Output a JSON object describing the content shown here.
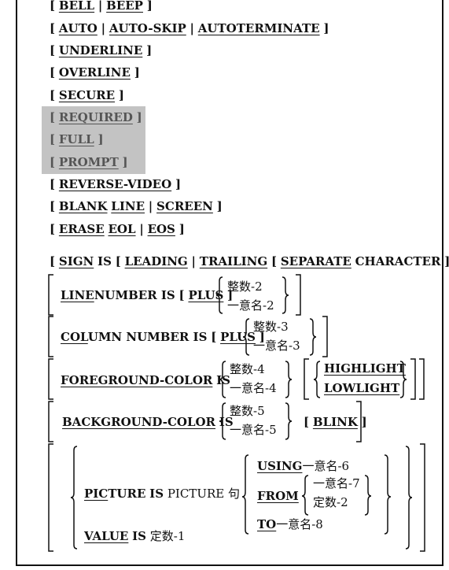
{
  "options": {
    "bell": {
      "open": "[",
      "a": "BELL",
      "sep": "|",
      "b": "BEEP",
      "close": "]"
    },
    "auto": {
      "open": "[",
      "a": "AUTO",
      "sep1": "|",
      "b": "AUTO-SKIP",
      "sep2": "|",
      "c": "AUTOTERMINATE",
      "close": "]"
    },
    "underline": {
      "open": "[",
      "a": "UNDERLINE",
      "close": "]"
    },
    "overline": {
      "open": "[",
      "a": "OVERLINE",
      "close": "]"
    },
    "secure": {
      "open": "[",
      "a": "SECURE",
      "close": "]"
    },
    "required": {
      "open": "[",
      "a": "REQUIRED",
      "close": "]"
    },
    "full": {
      "open": "[",
      "a": "FULL",
      "close": "]"
    },
    "prompt": {
      "open": "[",
      "a": "PROMPT",
      "close": "]"
    },
    "reverse": {
      "open": "[",
      "a": "REVERSE-VIDEO",
      "close": "]"
    },
    "blank": {
      "open": "[",
      "a": "BLANK",
      "a2": "LINE",
      "sep": "|",
      "b": "SCREEN",
      "close": "]"
    },
    "erase": {
      "open": "[",
      "a": "ERASE",
      "a2": "EOL",
      "sep": "|",
      "b": "EOS",
      "close": "]"
    }
  },
  "sign": {
    "open": "[",
    "sign": "SIGN",
    "is": "IS",
    "open2": "[",
    "leading": "LEADING",
    "sep": "|",
    "trailing": "TRAILING",
    "open3": "[",
    "separate": "SEPARATE",
    "character": "CHARACTER",
    "close": "] ]"
  },
  "line_number": {
    "line": "LINE",
    "rest": "NUMBER IS",
    "open": "[",
    "plus": "PLUS",
    "close": "]",
    "opt1": "整数-2",
    "opt2": "一意名-2"
  },
  "column_number": {
    "col": "COL",
    "rest": "UMN NUMBER IS",
    "open": "[",
    "plus": "PLUS",
    "close": "]",
    "opt1": "整数-3",
    "opt2": "一意名-3"
  },
  "foreground": {
    "kw": "FOREGROUND-COLOR",
    "is": "IS",
    "opt1": "整数-4",
    "opt2": "一意名-4",
    "hi": "HIGHLIGHT",
    "lo": "LOWLIGHT"
  },
  "background": {
    "kw": "BACKGROUND-COLOR",
    "is": "IS",
    "opt1": "整数-5",
    "opt2": "一意名-5",
    "open": "[",
    "blink": "BLINK",
    "close": "]"
  },
  "picture": {
    "pic": "PIC",
    "ture": "TURE",
    "is": "IS",
    "clause": "PICTURE 句",
    "using": "USING",
    "using_arg": "一意名-6",
    "from": "FROM",
    "from_opt1": "一意名-7",
    "from_opt2": "定数-2",
    "to": "TO",
    "to_arg": "一意名-8"
  },
  "value": {
    "kw": "VALUE",
    "is": "IS",
    "arg": "定数-1"
  }
}
